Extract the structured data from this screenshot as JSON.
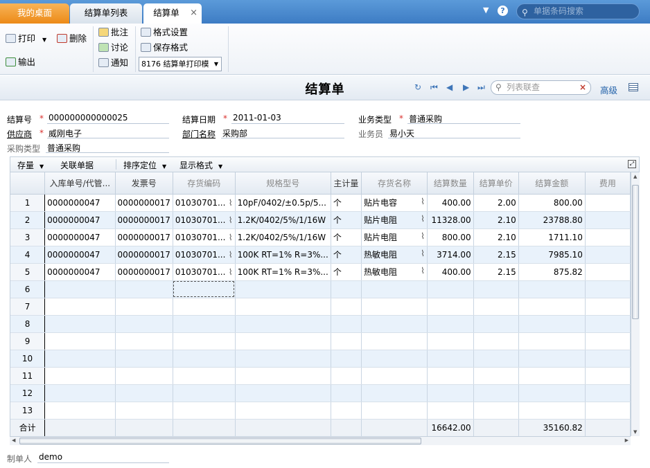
{
  "tabs": {
    "home": "我的桌面",
    "list": "结算单列表",
    "current": "结算单",
    "close": "×"
  },
  "topbar": {
    "search_placeholder": "单据条码搜索",
    "help": "?"
  },
  "toolbar": {
    "print": "打印",
    "delete": "删除",
    "export": "输出",
    "approve": "批注",
    "discuss": "讨论",
    "notify": "通知",
    "format_settings": "格式设置",
    "save_format": "保存格式",
    "print_template": "8176 结算单打印模"
  },
  "page": {
    "title": "结算单",
    "list_search_placeholder": "列表联查",
    "advanced": "高级"
  },
  "form": {
    "settle_no": {
      "label": "结算号",
      "value": "000000000000025"
    },
    "settle_date": {
      "label": "结算日期",
      "value": "2011-01-03"
    },
    "biz_type": {
      "label": "业务类型",
      "value": "普通采购"
    },
    "supplier": {
      "label": "供应商",
      "value": "威刚电子"
    },
    "dept": {
      "label": "部门名称",
      "value": "采购部"
    },
    "salesman": {
      "label": "业务员",
      "value": "易小天"
    },
    "purchase_type": {
      "label": "采购类型",
      "value": "普通采购"
    },
    "maker": {
      "label": "制单人",
      "value": "demo"
    }
  },
  "grid_toolbar": {
    "stock": "存量",
    "related": "关联单据",
    "sort": "排序定位",
    "display": "显示格式"
  },
  "columns": [
    "",
    "入库单号/代管...",
    "发票号",
    "存货编码",
    "规格型号",
    "主计量",
    "存货名称",
    "结算数量",
    "结算单价",
    "结算金额",
    "费用"
  ],
  "rows": [
    [
      "1",
      "0000000047",
      "0000000017",
      "01030701...",
      "10pF/0402/±0.5p/5...",
      "个",
      "贴片电容",
      "400.00",
      "2.00",
      "800.00",
      ""
    ],
    [
      "2",
      "0000000047",
      "0000000017",
      "01030701...",
      "1.2K/0402/5%/1/16W",
      "个",
      "贴片电阻",
      "11328.00",
      "2.10",
      "23788.80",
      ""
    ],
    [
      "3",
      "0000000047",
      "0000000017",
      "01030701...",
      "1.2K/0402/5%/1/16W",
      "个",
      "贴片电阻",
      "800.00",
      "2.10",
      "1711.10",
      ""
    ],
    [
      "4",
      "0000000047",
      "0000000017",
      "01030701...",
      "100K RT=1% R=3%...",
      "个",
      "热敏电阻",
      "3714.00",
      "2.15",
      "7985.10",
      ""
    ],
    [
      "5",
      "0000000047",
      "0000000017",
      "01030701...",
      "100K RT=1% R=3%...",
      "个",
      "热敏电阻",
      "400.00",
      "2.15",
      "875.82",
      ""
    ],
    [
      "6",
      "",
      "",
      "",
      "",
      "",
      "",
      "",
      "",
      "",
      ""
    ],
    [
      "7",
      "",
      "",
      "",
      "",
      "",
      "",
      "",
      "",
      "",
      ""
    ],
    [
      "8",
      "",
      "",
      "",
      "",
      "",
      "",
      "",
      "",
      "",
      ""
    ],
    [
      "9",
      "",
      "",
      "",
      "",
      "",
      "",
      "",
      "",
      "",
      ""
    ],
    [
      "10",
      "",
      "",
      "",
      "",
      "",
      "",
      "",
      "",
      "",
      ""
    ],
    [
      "11",
      "",
      "",
      "",
      "",
      "",
      "",
      "",
      "",
      "",
      ""
    ],
    [
      "12",
      "",
      "",
      "",
      "",
      "",
      "",
      "",
      "",
      "",
      ""
    ],
    [
      "13",
      "",
      "",
      "",
      "",
      "",
      "",
      "",
      "",
      "",
      ""
    ]
  ],
  "totals": {
    "label": "合计",
    "qty": "16642.00",
    "amount": "35160.82"
  }
}
